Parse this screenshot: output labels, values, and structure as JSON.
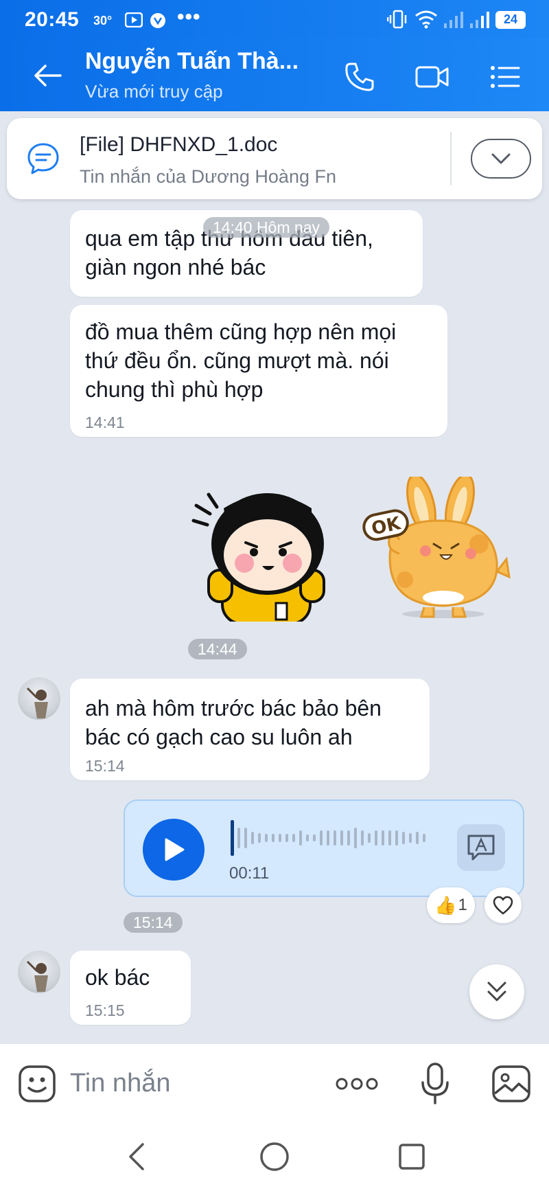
{
  "status_bar": {
    "time": "20:45",
    "temperature": "30°",
    "more": "•••",
    "battery": "24"
  },
  "header": {
    "contact_name": "Nguyễn Tuấn Thà...",
    "contact_status": "Vừa mới truy cập",
    "color": "#0a6ee8"
  },
  "pinned": {
    "title": "[File] DHFNXD_1.doc",
    "subtitle": "Tin nhắn của Dương Hoàng Fn"
  },
  "chat": {
    "date_divider": "14:40 Hôm nay",
    "messages": [
      {
        "text": "qua em tập thử hôm đầu tiên,\ngiàn ngon nhé bác"
      },
      {
        "text": "đồ mua thêm cũng hợp nên mọi\nthứ đều ổn. cũng mượt mà. nói\nchung thì phù hợp",
        "time": "14:41"
      },
      {
        "text": "ah mà hôm trước bác bảo bên\nbác có gạch cao su luôn ah",
        "time": "15:14"
      },
      {
        "text": "ok bác",
        "time": "15:15"
      }
    ],
    "sticker_time": "14:44",
    "sticker_text": "OK",
    "voice": {
      "duration": "00:11",
      "progress": 0.0
    },
    "voice_time": "15:14",
    "reaction": {
      "emoji": "👍",
      "count": "1"
    }
  },
  "composer": {
    "placeholder": "Tin nhắn"
  },
  "colors": {
    "accent": "#0d67e6",
    "chat_bg": "#e2e7ef",
    "voice_bubble": "#d4e9fe"
  },
  "icons": [
    "back-arrow-icon",
    "phone-icon",
    "video-camera-icon",
    "menu-list-icon",
    "chat-bubble-icon",
    "chevron-down-icon",
    "play-icon",
    "transcribe-icon",
    "thumbs-up-icon",
    "heart-icon",
    "double-chevron-down-icon",
    "emoji-icon",
    "more-dots-icon",
    "microphone-icon",
    "image-icon"
  ]
}
